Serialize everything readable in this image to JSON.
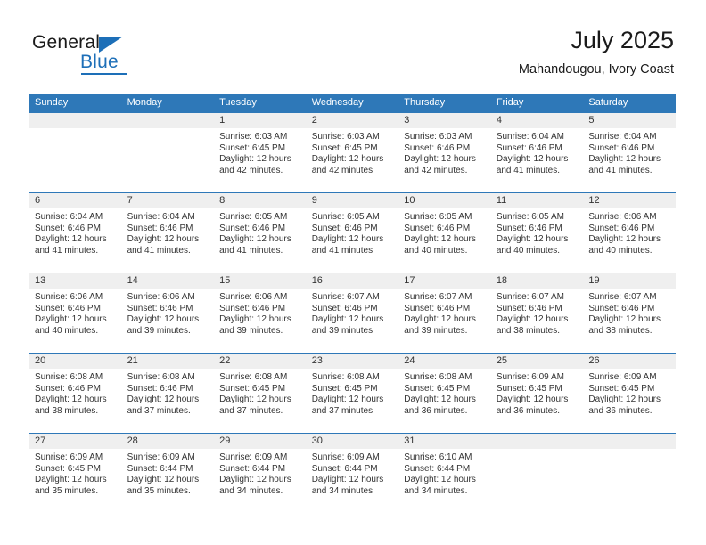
{
  "brand": {
    "name_part1": "General",
    "name_part2": "Blue",
    "triangle_icon": "triangle-icon",
    "accent_color": "#1d6fb8"
  },
  "header": {
    "title": "July 2025",
    "subtitle": "Mahandougou, Ivory Coast"
  },
  "theme": {
    "header_blue": "#2e78b8",
    "daynum_gray": "#efefef",
    "text": "#333333"
  },
  "weekdays": [
    "Sunday",
    "Monday",
    "Tuesday",
    "Wednesday",
    "Thursday",
    "Friday",
    "Saturday"
  ],
  "labels": {
    "sunrise_prefix": "Sunrise:",
    "sunset_prefix": "Sunset:",
    "daylight_prefix": "Daylight:"
  },
  "weeks": [
    [
      {
        "day": "",
        "empty": true,
        "line1": "",
        "line2": "",
        "line3": "",
        "line4": ""
      },
      {
        "day": "",
        "empty": true,
        "line1": "",
        "line2": "",
        "line3": "",
        "line4": ""
      },
      {
        "day": "1",
        "line1": "Sunrise: 6:03 AM",
        "line2": "Sunset: 6:45 PM",
        "line3": "Daylight: 12 hours",
        "line4": "and 42 minutes."
      },
      {
        "day": "2",
        "line1": "Sunrise: 6:03 AM",
        "line2": "Sunset: 6:45 PM",
        "line3": "Daylight: 12 hours",
        "line4": "and 42 minutes."
      },
      {
        "day": "3",
        "line1": "Sunrise: 6:03 AM",
        "line2": "Sunset: 6:46 PM",
        "line3": "Daylight: 12 hours",
        "line4": "and 42 minutes."
      },
      {
        "day": "4",
        "line1": "Sunrise: 6:04 AM",
        "line2": "Sunset: 6:46 PM",
        "line3": "Daylight: 12 hours",
        "line4": "and 41 minutes."
      },
      {
        "day": "5",
        "line1": "Sunrise: 6:04 AM",
        "line2": "Sunset: 6:46 PM",
        "line3": "Daylight: 12 hours",
        "line4": "and 41 minutes."
      }
    ],
    [
      {
        "day": "6",
        "line1": "Sunrise: 6:04 AM",
        "line2": "Sunset: 6:46 PM",
        "line3": "Daylight: 12 hours",
        "line4": "and 41 minutes."
      },
      {
        "day": "7",
        "line1": "Sunrise: 6:04 AM",
        "line2": "Sunset: 6:46 PM",
        "line3": "Daylight: 12 hours",
        "line4": "and 41 minutes."
      },
      {
        "day": "8",
        "line1": "Sunrise: 6:05 AM",
        "line2": "Sunset: 6:46 PM",
        "line3": "Daylight: 12 hours",
        "line4": "and 41 minutes."
      },
      {
        "day": "9",
        "line1": "Sunrise: 6:05 AM",
        "line2": "Sunset: 6:46 PM",
        "line3": "Daylight: 12 hours",
        "line4": "and 41 minutes."
      },
      {
        "day": "10",
        "line1": "Sunrise: 6:05 AM",
        "line2": "Sunset: 6:46 PM",
        "line3": "Daylight: 12 hours",
        "line4": "and 40 minutes."
      },
      {
        "day": "11",
        "line1": "Sunrise: 6:05 AM",
        "line2": "Sunset: 6:46 PM",
        "line3": "Daylight: 12 hours",
        "line4": "and 40 minutes."
      },
      {
        "day": "12",
        "line1": "Sunrise: 6:06 AM",
        "line2": "Sunset: 6:46 PM",
        "line3": "Daylight: 12 hours",
        "line4": "and 40 minutes."
      }
    ],
    [
      {
        "day": "13",
        "line1": "Sunrise: 6:06 AM",
        "line2": "Sunset: 6:46 PM",
        "line3": "Daylight: 12 hours",
        "line4": "and 40 minutes."
      },
      {
        "day": "14",
        "line1": "Sunrise: 6:06 AM",
        "line2": "Sunset: 6:46 PM",
        "line3": "Daylight: 12 hours",
        "line4": "and 39 minutes."
      },
      {
        "day": "15",
        "line1": "Sunrise: 6:06 AM",
        "line2": "Sunset: 6:46 PM",
        "line3": "Daylight: 12 hours",
        "line4": "and 39 minutes."
      },
      {
        "day": "16",
        "line1": "Sunrise: 6:07 AM",
        "line2": "Sunset: 6:46 PM",
        "line3": "Daylight: 12 hours",
        "line4": "and 39 minutes."
      },
      {
        "day": "17",
        "line1": "Sunrise: 6:07 AM",
        "line2": "Sunset: 6:46 PM",
        "line3": "Daylight: 12 hours",
        "line4": "and 39 minutes."
      },
      {
        "day": "18",
        "line1": "Sunrise: 6:07 AM",
        "line2": "Sunset: 6:46 PM",
        "line3": "Daylight: 12 hours",
        "line4": "and 38 minutes."
      },
      {
        "day": "19",
        "line1": "Sunrise: 6:07 AM",
        "line2": "Sunset: 6:46 PM",
        "line3": "Daylight: 12 hours",
        "line4": "and 38 minutes."
      }
    ],
    [
      {
        "day": "20",
        "line1": "Sunrise: 6:08 AM",
        "line2": "Sunset: 6:46 PM",
        "line3": "Daylight: 12 hours",
        "line4": "and 38 minutes."
      },
      {
        "day": "21",
        "line1": "Sunrise: 6:08 AM",
        "line2": "Sunset: 6:46 PM",
        "line3": "Daylight: 12 hours",
        "line4": "and 37 minutes."
      },
      {
        "day": "22",
        "line1": "Sunrise: 6:08 AM",
        "line2": "Sunset: 6:45 PM",
        "line3": "Daylight: 12 hours",
        "line4": "and 37 minutes."
      },
      {
        "day": "23",
        "line1": "Sunrise: 6:08 AM",
        "line2": "Sunset: 6:45 PM",
        "line3": "Daylight: 12 hours",
        "line4": "and 37 minutes."
      },
      {
        "day": "24",
        "line1": "Sunrise: 6:08 AM",
        "line2": "Sunset: 6:45 PM",
        "line3": "Daylight: 12 hours",
        "line4": "and 36 minutes."
      },
      {
        "day": "25",
        "line1": "Sunrise: 6:09 AM",
        "line2": "Sunset: 6:45 PM",
        "line3": "Daylight: 12 hours",
        "line4": "and 36 minutes."
      },
      {
        "day": "26",
        "line1": "Sunrise: 6:09 AM",
        "line2": "Sunset: 6:45 PM",
        "line3": "Daylight: 12 hours",
        "line4": "and 36 minutes."
      }
    ],
    [
      {
        "day": "27",
        "line1": "Sunrise: 6:09 AM",
        "line2": "Sunset: 6:45 PM",
        "line3": "Daylight: 12 hours",
        "line4": "and 35 minutes."
      },
      {
        "day": "28",
        "line1": "Sunrise: 6:09 AM",
        "line2": "Sunset: 6:44 PM",
        "line3": "Daylight: 12 hours",
        "line4": "and 35 minutes."
      },
      {
        "day": "29",
        "line1": "Sunrise: 6:09 AM",
        "line2": "Sunset: 6:44 PM",
        "line3": "Daylight: 12 hours",
        "line4": "and 34 minutes."
      },
      {
        "day": "30",
        "line1": "Sunrise: 6:09 AM",
        "line2": "Sunset: 6:44 PM",
        "line3": "Daylight: 12 hours",
        "line4": "and 34 minutes."
      },
      {
        "day": "31",
        "line1": "Sunrise: 6:10 AM",
        "line2": "Sunset: 6:44 PM",
        "line3": "Daylight: 12 hours",
        "line4": "and 34 minutes."
      },
      {
        "day": "",
        "empty": true,
        "line1": "",
        "line2": "",
        "line3": "",
        "line4": ""
      },
      {
        "day": "",
        "empty": true,
        "line1": "",
        "line2": "",
        "line3": "",
        "line4": ""
      }
    ]
  ]
}
